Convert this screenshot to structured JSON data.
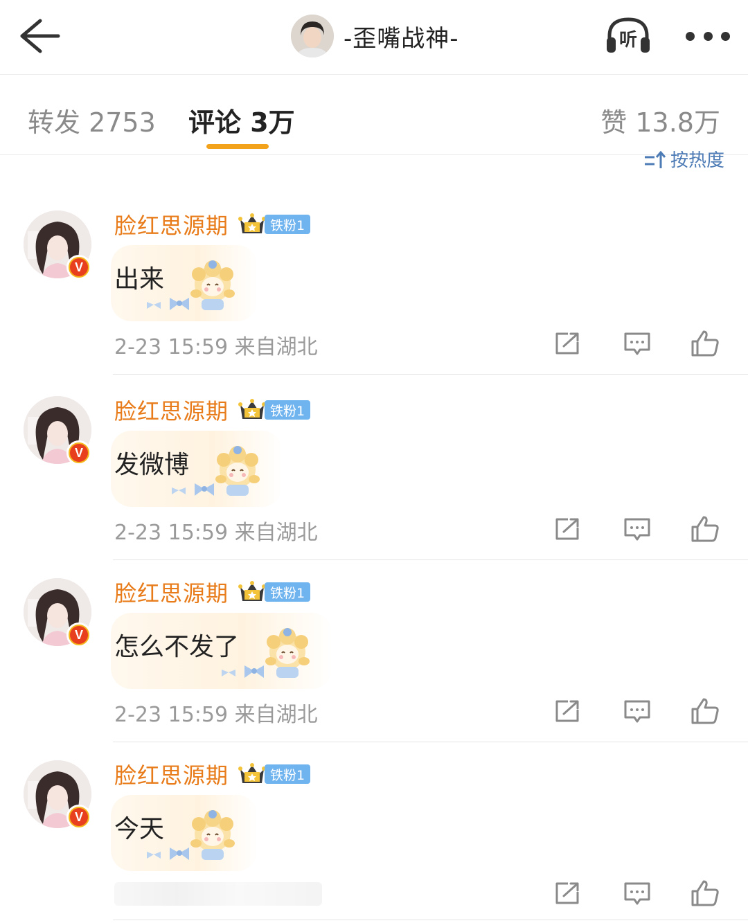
{
  "header": {
    "back_icon": "arrow-left-icon",
    "title": "-歪嘴战神-",
    "listen_icon": "headphones-icon",
    "listen_label": "听",
    "more_icon": "more-dots-icon"
  },
  "tabs": {
    "repost": "转发 2753",
    "comment": "评论 3万",
    "like": "赞 13.8万",
    "active": "comment",
    "accent_color": "#f2a21b"
  },
  "sort": {
    "label": "按热度",
    "icon": "sort-arrows-icon"
  },
  "comments": [
    {
      "username": "脸红思源期",
      "fan_badge": "铁粉1",
      "text": "出来",
      "time": "2-23 15:59",
      "location": "来自湖北"
    },
    {
      "username": "脸红思源期",
      "fan_badge": "铁粉1",
      "text": "发微博",
      "time": "2-23 15:59",
      "location": "来自湖北"
    },
    {
      "username": "脸红思源期",
      "fan_badge": "铁粉1",
      "text": "怎么不发了",
      "time": "2-23 15:59",
      "location": "来自湖北"
    },
    {
      "username": "脸红思源期",
      "fan_badge": "铁粉1",
      "text": "今天",
      "time": "",
      "location": ""
    }
  ],
  "colors": {
    "username": "#e87b1a",
    "fan_badge": "#6fb3ef",
    "sort_link": "#4d7bb5",
    "verified_badge": "#e8401f"
  }
}
